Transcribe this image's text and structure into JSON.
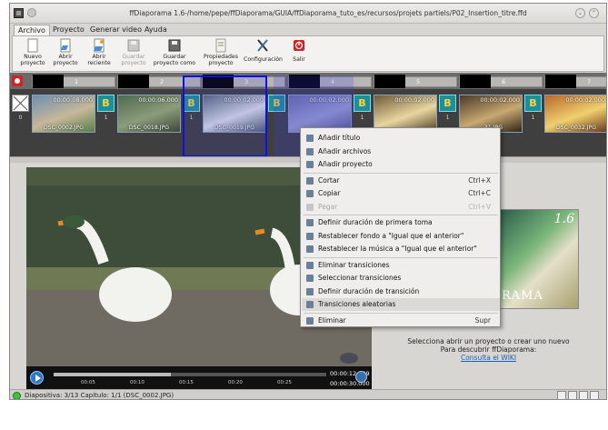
{
  "window": {
    "title": "ffDiaporama 1.6-/home/pepe/ffDiaporama/GUIA/ffDiaporama_tuto_es/recursos/projets partiels/P02_Insertion_titre.ffd",
    "controls": [
      "minimize",
      "maximize",
      "close"
    ]
  },
  "menu": {
    "tabs": [
      "Archivo",
      "Proyecto",
      "Generar video",
      "Ayuda"
    ],
    "active": "Archivo"
  },
  "ribbon": {
    "buttons": [
      {
        "label1": "Nuevo",
        "label2": "proyecto",
        "icon": "new-document-icon",
        "enabled": true
      },
      {
        "label1": "Abrir",
        "label2": "proyecto",
        "icon": "open-document-icon",
        "enabled": true
      },
      {
        "label1": "Abrir",
        "label2": "reciente",
        "icon": "open-recent-icon",
        "enabled": true
      },
      {
        "label1": "Guardar",
        "label2": "proyecto",
        "icon": "save-icon",
        "enabled": false
      },
      {
        "label1": "Guardar",
        "label2": "proyecto como",
        "icon": "save-as-icon",
        "enabled": true
      },
      {
        "label1": "Propiedades",
        "label2": "proyecto",
        "icon": "properties-icon",
        "enabled": true
      },
      {
        "label1": "Configuración",
        "label2": "",
        "icon": "settings-icon",
        "enabled": true
      },
      {
        "label1": "Salir",
        "label2": "",
        "icon": "power-icon",
        "enabled": true
      }
    ]
  },
  "timeline": {
    "chapters": [
      "1",
      "2",
      "3",
      "4",
      "5",
      "6",
      "7"
    ],
    "slides": [
      {
        "duration": "00:00:08.000",
        "file": "DSC_0002.JPG",
        "transition_num": "0",
        "colors": [
          "#6d8fb0",
          "#c7b79a",
          "#5a7f4a"
        ]
      },
      {
        "duration": "00:00:06.000",
        "file": "DSC_0018.JPG",
        "transition_num": "1",
        "colors": [
          "#4f6a50",
          "#8b9c7a",
          "#3b4a3a"
        ]
      },
      {
        "duration": "00:00:02.000",
        "file": "DSC_0019.JPG",
        "transition_num": "1",
        "colors": [
          "#5b6b78",
          "#d9dde2",
          "#4b5d6b"
        ]
      },
      {
        "duration": "00:00:02.000",
        "file": "",
        "transition_num": "",
        "colors": [
          "#6a6fa4",
          "#9aa0c8",
          "#55598c"
        ]
      },
      {
        "duration": "00:00:02.000",
        "file": "",
        "transition_num": "1",
        "colors": [
          "#6d5a3a",
          "#e8d6a0",
          "#4e3c24"
        ]
      },
      {
        "duration": "00:00:02.000",
        "file": "...31.JPG",
        "transition_num": "1",
        "colors": [
          "#4a3a2a",
          "#c9a870",
          "#2e2418"
        ]
      },
      {
        "duration": "00:00:02.000",
        "file": "DSC_0032.JPG",
        "transition_num": "1",
        "colors": [
          "#b86a2a",
          "#f0d070",
          "#6a3a1a"
        ]
      }
    ]
  },
  "context_menu": {
    "items": [
      {
        "label": "Añadir título",
        "shortcut": "",
        "icon": "title-icon",
        "enabled": true,
        "highlighted": false
      },
      {
        "label": "Añadir archivos",
        "shortcut": "",
        "icon": "add-files-icon",
        "enabled": true,
        "highlighted": false
      },
      {
        "label": "Añadir proyecto",
        "shortcut": "",
        "icon": "add-project-icon",
        "enabled": true,
        "highlighted": false
      },
      {
        "sep": true
      },
      {
        "label": "Cortar",
        "shortcut": "Ctrl+X",
        "icon": "cut-icon",
        "enabled": true,
        "highlighted": false
      },
      {
        "label": "Copiar",
        "shortcut": "Ctrl+C",
        "icon": "copy-icon",
        "enabled": true,
        "highlighted": false
      },
      {
        "label": "Pegar",
        "shortcut": "Ctrl+V",
        "icon": "paste-icon",
        "enabled": false,
        "highlighted": false
      },
      {
        "sep": true
      },
      {
        "label": "Definir duración de primera toma",
        "shortcut": "",
        "icon": "duration-icon",
        "enabled": true,
        "highlighted": false
      },
      {
        "label": "Restablecer fondo a \"Igual que el anterior\"",
        "shortcut": "",
        "icon": "background-icon",
        "enabled": true,
        "highlighted": false
      },
      {
        "label": "Restablecer la música a \"Igual que el anterior\"",
        "shortcut": "",
        "icon": "music-icon",
        "enabled": true,
        "highlighted": false
      },
      {
        "sep": true
      },
      {
        "label": "Eliminar transiciones",
        "shortcut": "",
        "icon": "remove-transitions-icon",
        "enabled": true,
        "highlighted": false
      },
      {
        "label": "Seleccionar transiciones",
        "shortcut": "",
        "icon": "select-transitions-icon",
        "enabled": true,
        "highlighted": false
      },
      {
        "label": "Definir duración de transición",
        "shortcut": "",
        "icon": "transition-duration-icon",
        "enabled": true,
        "highlighted": false
      },
      {
        "label": "Transiciones aleatorias",
        "shortcut": "",
        "icon": "random-transitions-icon",
        "enabled": true,
        "highlighted": true
      },
      {
        "sep": true
      },
      {
        "label": "Eliminar",
        "shortcut": "Supr",
        "icon": "delete-icon",
        "enabled": true,
        "highlighted": false
      }
    ]
  },
  "player": {
    "current_time": "00:00:12.999",
    "total_time": "00:00:30.000",
    "ticks": [
      "00:05",
      "00:10",
      "00:15",
      "00:20",
      "00:25"
    ],
    "progress": 0.43
  },
  "info_panel": {
    "version": "1.6",
    "splash_word": "RAMA",
    "line1": "Selecciona abrir un proyecto o crear uno nuevo",
    "line2": "Para descubrir ffDiaporama:",
    "link": "Consulta el WIKI"
  },
  "status": {
    "text": "Diapositiva: 3/13  Capítulo: 1/1 (DSC_0002.JPG)"
  }
}
